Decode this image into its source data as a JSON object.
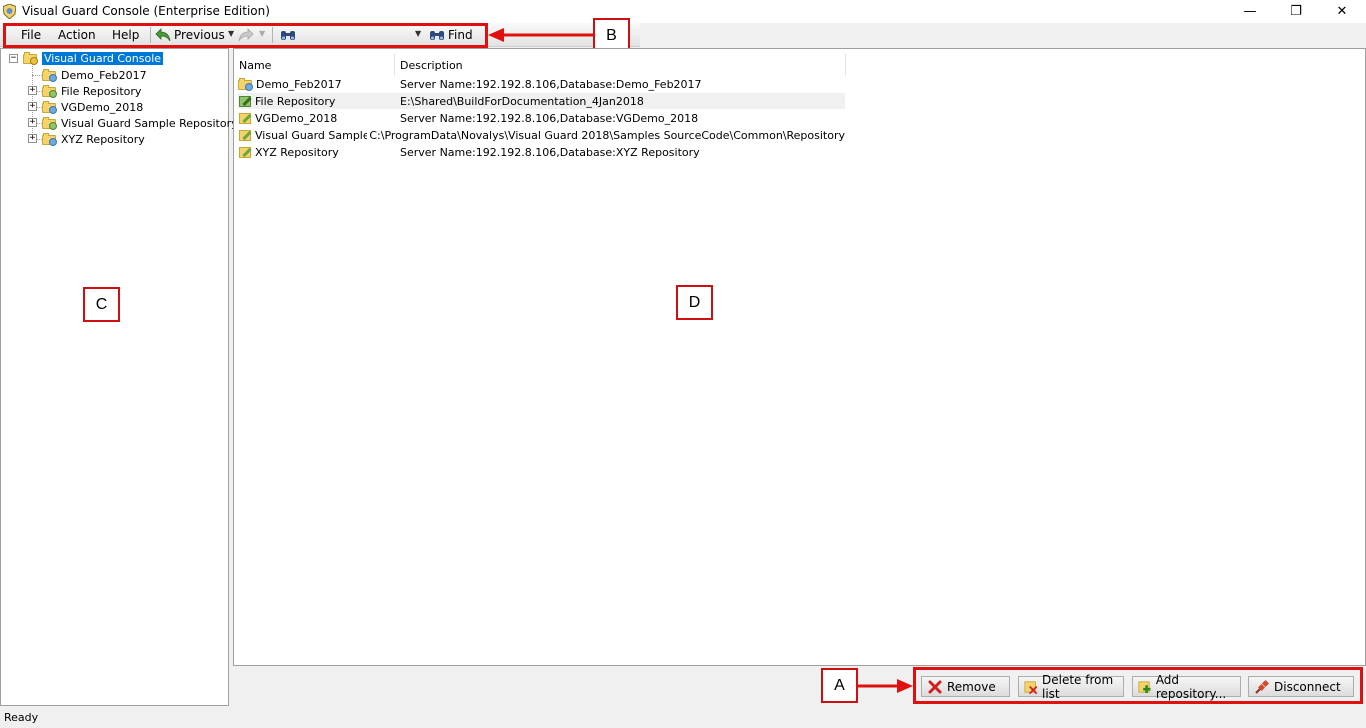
{
  "window": {
    "title": "Visual Guard Console (Enterprise Edition)",
    "minimize": "—",
    "restore": "❐",
    "close": "✕"
  },
  "menu": {
    "file": "File",
    "action": "Action",
    "help": "Help"
  },
  "toolbar": {
    "previous_label": "Previous",
    "find_label": "Find",
    "find_value": ""
  },
  "tree": {
    "root": "Visual Guard Console",
    "items": [
      {
        "label": "Demo_Feb2017",
        "expandable": false
      },
      {
        "label": "File Repository",
        "expandable": true
      },
      {
        "label": "VGDemo_2018",
        "expandable": true
      },
      {
        "label": "Visual Guard Sample Repository",
        "expandable": true
      },
      {
        "label": "XYZ Repository",
        "expandable": true
      }
    ]
  },
  "list": {
    "columns": [
      "Name",
      "Description"
    ],
    "rows": [
      {
        "name": "Demo_Feb2017",
        "description": "Server Name:192.192.8.106,Database:Demo_Feb2017"
      },
      {
        "name": "File Repository",
        "description": "E:\\Shared\\BuildForDocumentation_4Jan2018"
      },
      {
        "name": "VGDemo_2018",
        "description": "Server Name:192.192.8.106,Database:VGDemo_2018"
      },
      {
        "name": "Visual Guard Sample Repo...",
        "description": "C:\\ProgramData\\Novalys\\Visual Guard 2018\\Samples SourceCode\\Common\\Repository"
      },
      {
        "name": "XYZ Repository",
        "description": "Server Name:192.192.8.106,Database:XYZ Repository"
      }
    ]
  },
  "buttons": {
    "remove": "Remove",
    "delete_from_list": "Delete from list",
    "add_repository": "Add repository...",
    "disconnect": "Disconnect"
  },
  "annotations": {
    "a": "A",
    "b": "B",
    "c": "C",
    "d": "D"
  },
  "status": {
    "text": "Ready"
  },
  "colors": {
    "annotation_red": "#e01010",
    "selection_blue": "#0078d7"
  }
}
